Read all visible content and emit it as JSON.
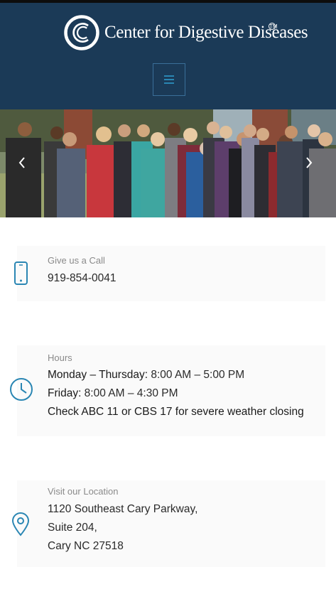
{
  "header": {
    "logo_text": "Center for Digestive Diseases",
    "trademark": "TM",
    "menu_icon": "hamburger-icon"
  },
  "hero": {
    "prev_icon": "chevron-left-icon",
    "next_icon": "chevron-right-icon"
  },
  "contact": {
    "label": "Give us a Call",
    "phone": "919-854-0041",
    "icon": "phone-icon"
  },
  "hours": {
    "label": "Hours",
    "icon": "clock-icon",
    "weekday_label": "Monday – Thursday:",
    "weekday_time": " 8:00 AM – 5:00 PM",
    "friday_label": "Friday:",
    "friday_time": " 8:00 AM – 4:30 PM",
    "weather_note": "Check ABC 11 or CBS 17 for severe weather closing"
  },
  "location": {
    "label": "Visit our Location",
    "icon": "map-pin-icon",
    "line1": "1120 Southeast Cary Parkway,",
    "line2": "Suite 204,",
    "line3": "Cary NC 27518"
  },
  "colors": {
    "header_bg": "#1b3a57",
    "accent": "#2a86b3"
  }
}
